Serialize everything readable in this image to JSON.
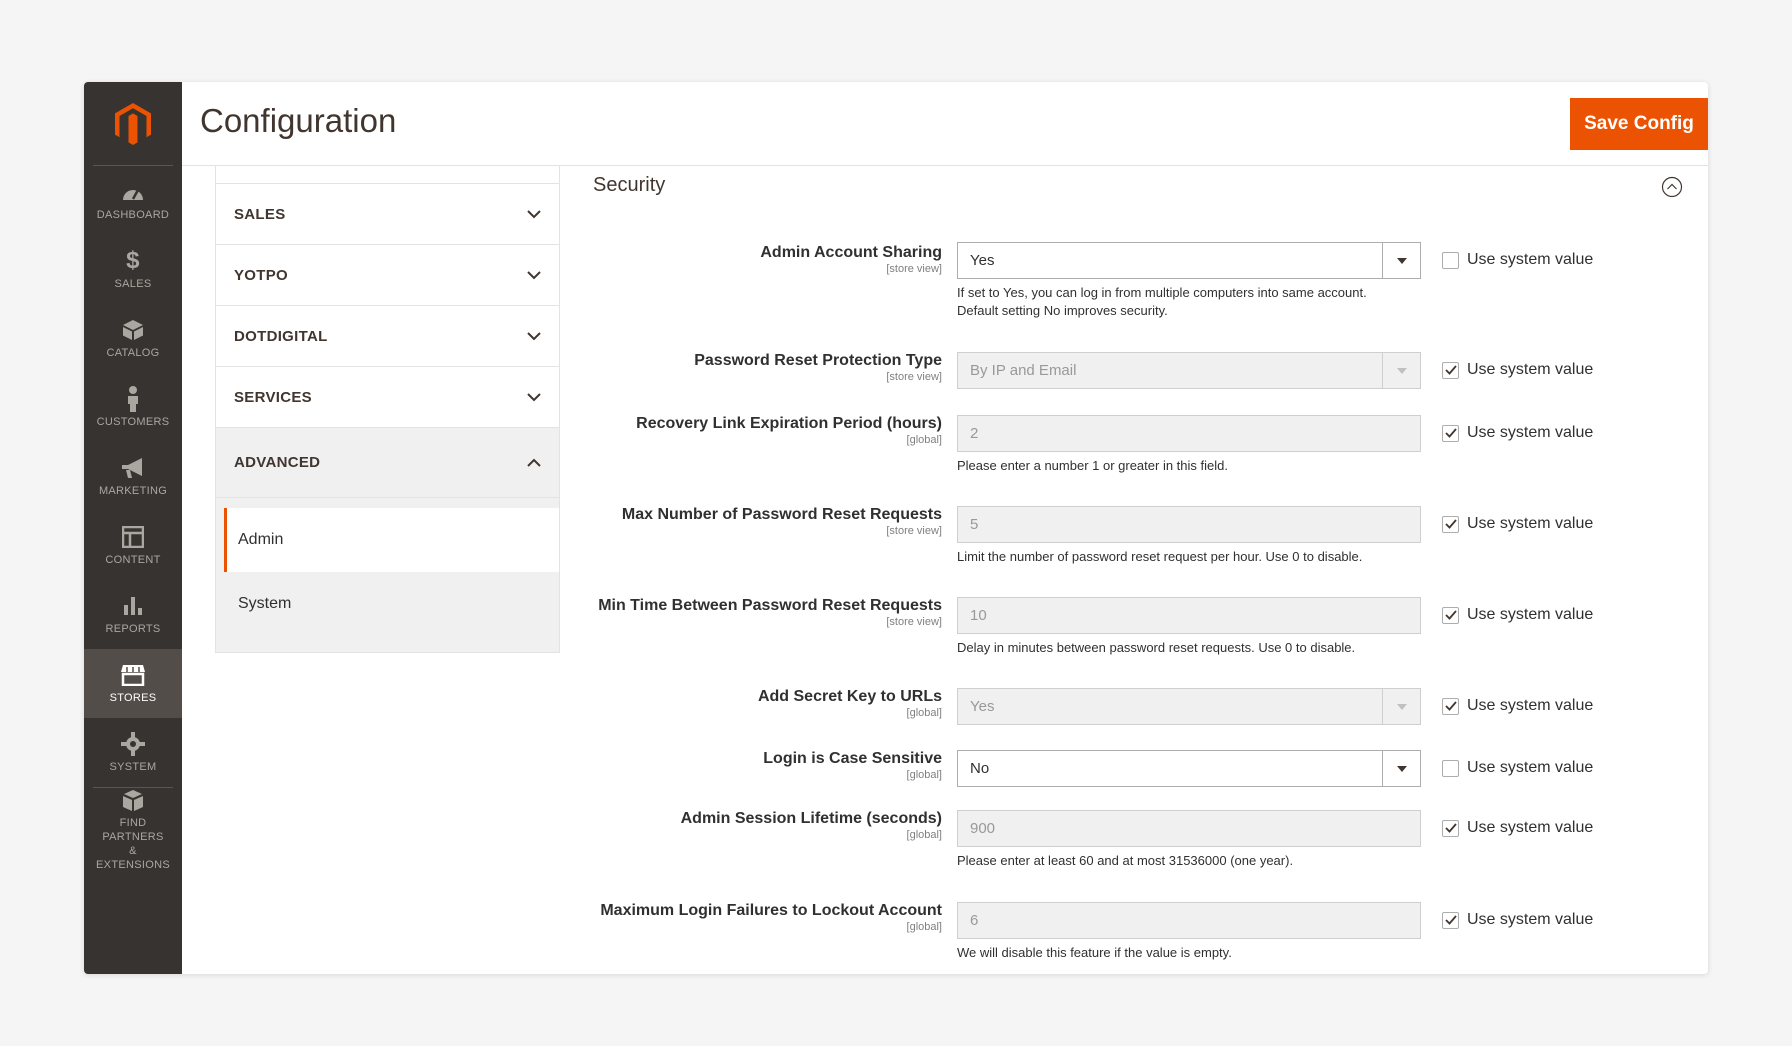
{
  "header": {
    "title": "Configuration",
    "save_label": "Save Config"
  },
  "nav": [
    {
      "label": "DASHBOARD",
      "icon": "dashboard-icon"
    },
    {
      "label": "SALES",
      "icon": "dollar-icon"
    },
    {
      "label": "CATALOG",
      "icon": "box-icon"
    },
    {
      "label": "CUSTOMERS",
      "icon": "person-icon"
    },
    {
      "label": "MARKETING",
      "icon": "megaphone-icon"
    },
    {
      "label": "CONTENT",
      "icon": "layout-icon"
    },
    {
      "label": "REPORTS",
      "icon": "bar-chart-icon"
    },
    {
      "label": "STORES",
      "icon": "store-icon",
      "active": true
    },
    {
      "label": "SYSTEM",
      "icon": "gear-icon"
    },
    {
      "label_line1": "FIND PARTNERS",
      "label_line2": "& EXTENSIONS",
      "icon": "cubes-icon"
    }
  ],
  "tabs": [
    "SALES",
    "YOTPO",
    "DOTDIGITAL",
    "SERVICES",
    "ADVANCED"
  ],
  "advanced_items": [
    "Admin",
    "System"
  ],
  "section": {
    "title": "Security"
  },
  "fields": [
    {
      "label": "Admin Account Sharing",
      "scope": "[store view]",
      "value": "Yes",
      "note1": "If set to Yes, you can log in from multiple computers into same account.",
      "note2": "Default setting No improves security.",
      "sys": "Use system value"
    },
    {
      "label": "Password Reset Protection Type",
      "scope": "[store view]",
      "value": "By IP and Email",
      "sys": "Use system value"
    },
    {
      "label": "Recovery Link Expiration Period (hours)",
      "scope": "[global]",
      "value": "2",
      "note1": "Please enter a number 1 or greater in this field.",
      "sys": "Use system value"
    },
    {
      "label": "Max Number of Password Reset Requests",
      "scope": "[store view]",
      "value": "5",
      "note1": "Limit the number of password reset request per hour. Use 0 to disable.",
      "sys": "Use system value"
    },
    {
      "label": "Min Time Between Password Reset Requests",
      "scope": "[store view]",
      "value": "10",
      "note1": "Delay in minutes between password reset requests. Use 0 to disable.",
      "sys": "Use system value"
    },
    {
      "label": "Add Secret Key to URLs",
      "scope": "[global]",
      "value": "Yes",
      "sys": "Use system value"
    },
    {
      "label": "Login is Case Sensitive",
      "scope": "[global]",
      "value": "No",
      "sys": "Use system value"
    },
    {
      "label": "Admin Session Lifetime (seconds)",
      "scope": "[global]",
      "value": "900",
      "note1": "Please enter at least 60 and at most 31536000 (one year).",
      "sys": "Use system value"
    },
    {
      "label": "Maximum Login Failures to Lockout Account",
      "scope": "[global]",
      "value": "6",
      "note1": "We will disable this feature if the value is empty.",
      "sys": "Use system value"
    }
  ],
  "colors": {
    "accent": "#eb5202",
    "nav_bg": "#373330"
  }
}
